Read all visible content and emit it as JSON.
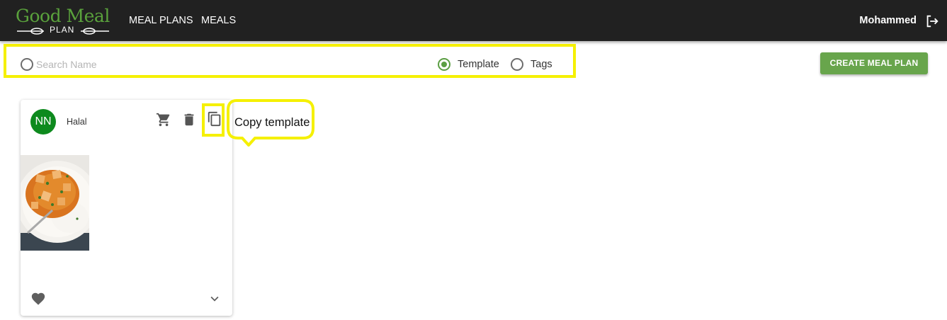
{
  "header": {
    "logo_title": "Good Meal",
    "logo_subtitle": "PLAN",
    "nav": [
      "MEAL PLANS",
      "MEALS"
    ],
    "user_name": "Mohammed",
    "logout_icon": "logout-icon"
  },
  "filters": {
    "search_placeholder": "Search Name",
    "options": [
      {
        "label": "Template",
        "selected": true
      },
      {
        "label": "Tags",
        "selected": false
      }
    ]
  },
  "actions": {
    "create_label": "CREATE MEAL PLAN"
  },
  "card": {
    "avatar_initials": "NN",
    "title": "Halal",
    "icons": [
      "cart-icon",
      "delete-icon",
      "copy-icon",
      "heart-icon",
      "chevron-down-icon"
    ]
  },
  "tooltip": {
    "text": "Copy template"
  },
  "colors": {
    "appbar": "#212121",
    "brand_green": "#5aa23c",
    "button_green": "#68a54c",
    "avatar_green": "#0e8a1e",
    "highlight_yellow": "#f5f000"
  }
}
